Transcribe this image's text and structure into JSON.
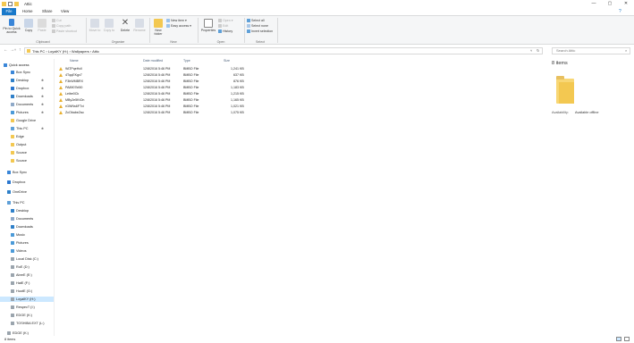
{
  "window": {
    "title": "Attic",
    "controls": {
      "minimize": "—",
      "maximize": "▢",
      "close": "✕"
    }
  },
  "tabs": [
    "File",
    "Home",
    "Share",
    "View"
  ],
  "ribbon": {
    "pin_label": "Pin to Quick access",
    "copy_label": "Copy",
    "paste_label": "Paste",
    "cut_label": "Cut",
    "copy_path_label": "Copy path",
    "paste_shortcut_label": "Paste shortcut",
    "move_to_label": "Move to",
    "copy_to_label": "Copy to",
    "delete_label": "Delete",
    "rename_label": "Rename",
    "new_folder_label": "New folder",
    "new_item_label": "New item ▾",
    "easy_access_label": "Easy access ▾",
    "properties_label": "Properties",
    "open_label": "Open ▾",
    "edit_label": "Edit",
    "history_label": "History",
    "select_all_label": "Select all",
    "select_none_label": "Select none",
    "invert_selection_label": "Invert selection",
    "groups": [
      "Clipboard",
      "Organize",
      "New",
      "Open",
      "Select"
    ]
  },
  "address": {
    "breadcrumb": "This PC  ›  LoyalKY (H:)  ›  Wallpapers  ›  Attic",
    "search_placeholder": "Search Attic"
  },
  "nav": {
    "quick_access": "Quick access",
    "items": [
      "Box Sync",
      "Desktop",
      "Dropbox",
      "Downloads",
      "Documents",
      "Pictures",
      "Google Drive",
      "This PC",
      "Edge",
      "Output",
      "Source",
      "Source"
    ],
    "box_sync": "Box Sync",
    "dropbox": "Dropbox",
    "onedrive": "OneDrive",
    "this_pc": "This PC",
    "pc_items": [
      "Desktop",
      "Documents",
      "Downloads",
      "Music",
      "Pictures",
      "Videos",
      "Local Disk (C:)",
      "RoE (D:)",
      "AbreE (E:)",
      "HatE (F:)",
      "HuotE (G:)",
      "LoyalKY (H:)",
      "RespecT (I:)",
      "EDGE (K:)",
      "TOSHIBA EXT (L:)"
    ],
    "edge_drive": "EDGE (K:)"
  },
  "list": {
    "columns": {
      "name": "Name",
      "date": "Date modified",
      "type": "Type",
      "size": "Size"
    },
    "rows": [
      {
        "name": "9ATPqeHcll",
        "date": "12/8/2016 5:46 PM",
        "type": "BMBO File",
        "size": "1,241 KB"
      },
      {
        "name": "4TqqEKgx7",
        "date": "12/8/2016 5:46 PM",
        "type": "BMBO File",
        "size": "637 KB"
      },
      {
        "name": "F3bWMBRX",
        "date": "12/8/2016 5:46 PM",
        "type": "BMBO File",
        "size": "876 KB"
      },
      {
        "name": "PA8907kt50",
        "date": "12/8/2016 5:46 PM",
        "type": "BMBO File",
        "size": "1,183 KB"
      },
      {
        "name": "Leibe0Ck",
        "date": "12/8/2016 5:46 PM",
        "type": "BMBO File",
        "size": "1,215 KB"
      },
      {
        "name": "MBy2e5KtOn",
        "date": "12/8/2016 5:46 PM",
        "type": "BMBO File",
        "size": "1,165 KB"
      },
      {
        "name": "rGWNs6FTvi",
        "date": "12/8/2016 5:46 PM",
        "type": "BMBO File",
        "size": "1,021 KB"
      },
      {
        "name": "ZcObabsOsc",
        "date": "12/8/2016 5:46 PM",
        "type": "BMBO File",
        "size": "1,075 KB"
      }
    ]
  },
  "details": {
    "count": "8 items",
    "availability_label": "Availability:",
    "availability_value": "Available offline"
  },
  "status": {
    "count": "8 items"
  },
  "colors": {
    "accent": "#1979ca",
    "folder": "#f8d775",
    "selection": "#cce8ff"
  }
}
